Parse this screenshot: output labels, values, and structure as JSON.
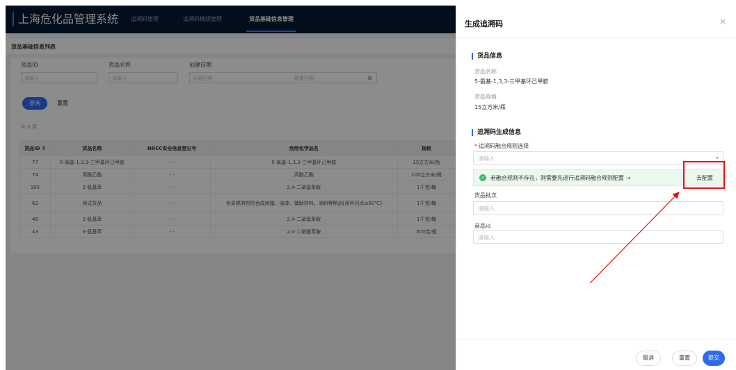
{
  "app": {
    "title": "上海危化品管理系统",
    "nav": [
      "追溯码管理",
      "追溯码模版管理",
      "货品基础信息管理"
    ]
  },
  "list_page": {
    "header": "货品基础信息列表",
    "filters": {
      "id_label": "货品ID",
      "id_placeholder": "请输入",
      "name_label": "货品名称",
      "name_placeholder": "请输入",
      "date_label": "创建日期",
      "start_placeholder": "开始日期",
      "end_placeholder": "结束日期"
    },
    "query_label": "查询",
    "reset_label": "重置",
    "count": "共 6 项",
    "columns": [
      "货品ID ↕",
      "货品名称",
      "NRCC安全信息登记号",
      "危险化学品名",
      "规格"
    ],
    "rows": [
      [
        "77",
        "5-氯基-1,3,3-三甲基环己甲胺",
        "- -",
        "5-氯基-1,3,3-三甲基环己甲胺",
        "15立方米/瓶"
      ],
      [
        "74",
        "丙酸乙酯",
        "- -",
        "丙酸乙酯",
        "100立方米/桶"
      ],
      [
        "105",
        "3-氨基苯",
        "- -",
        "2,4-二硝基苯胺",
        "1千克/桶"
      ],
      [
        "62",
        "测试货品",
        "- -",
        "含易燃溶剂的合成树脂、油漆、辅助材料、涂料等制品[闭杯闪点≤60℃]",
        "1千克/桶"
      ],
      [
        "46",
        "3-氨基苯",
        "- -",
        "2,4-二硝基苯胺",
        "1千克/桶"
      ],
      [
        "43",
        "3-氨基苯",
        "- -",
        "2,4-二硝基苯胺",
        "500克/瓶"
      ]
    ]
  },
  "drawer": {
    "title": "生成追溯码",
    "close": "×",
    "goods_section": "货品信息",
    "goods_name_label": "货品名称",
    "goods_name_value": "5-氨基-1,3,3-三甲基环己甲胺",
    "spec_label": "货品规格",
    "spec_value": "15立方米/瓶",
    "gen_section": "追溯码生成信息",
    "rule_label": "追溯码融合规则选择",
    "rule_placeholder": "请输入",
    "notice_text": "若融合规则不存在，则需要先进行追溯码融合规则配置 →",
    "notice_action": "去配置",
    "batch_label": "货品批次",
    "batch_placeholder": "请输入",
    "product_label": "商品id",
    "product_placeholder": "请输入",
    "cancel_label": "取消",
    "reset_label": "重置",
    "submit_label": "提交"
  },
  "colors": {
    "primary": "#2e6bf0",
    "nav_bg": "#071a36",
    "notice_bg": "#ebf8ee",
    "success": "#3cba6a",
    "annotation_red": "#e11111"
  }
}
